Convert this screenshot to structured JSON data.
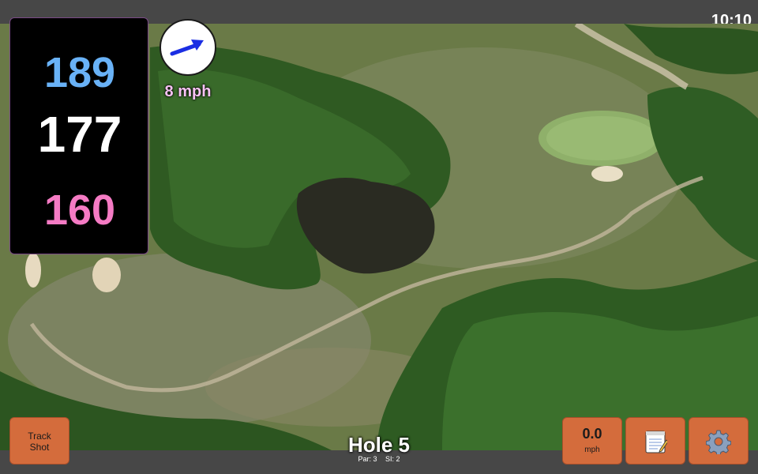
{
  "status": {
    "time": "10:10"
  },
  "distances": {
    "back": "189",
    "middle": "177",
    "front": "160"
  },
  "wind": {
    "speed_label": "8 mph",
    "icon": "wind-direction-arrow-icon"
  },
  "hole": {
    "title": "Hole 5",
    "par_label": "Par: 3",
    "si_label": "SI: 2"
  },
  "buttons": {
    "track_shot": [
      "Track",
      "Shot"
    ],
    "speed": {
      "value": "0.0",
      "unit": "mph"
    },
    "notes_icon": "notepad-icon",
    "settings_icon": "gear-icon"
  },
  "colors": {
    "back": "#69b2f7",
    "middle": "#ffffff",
    "front": "#f57bc4",
    "button": "#d46c3c",
    "bar": "#474747"
  }
}
